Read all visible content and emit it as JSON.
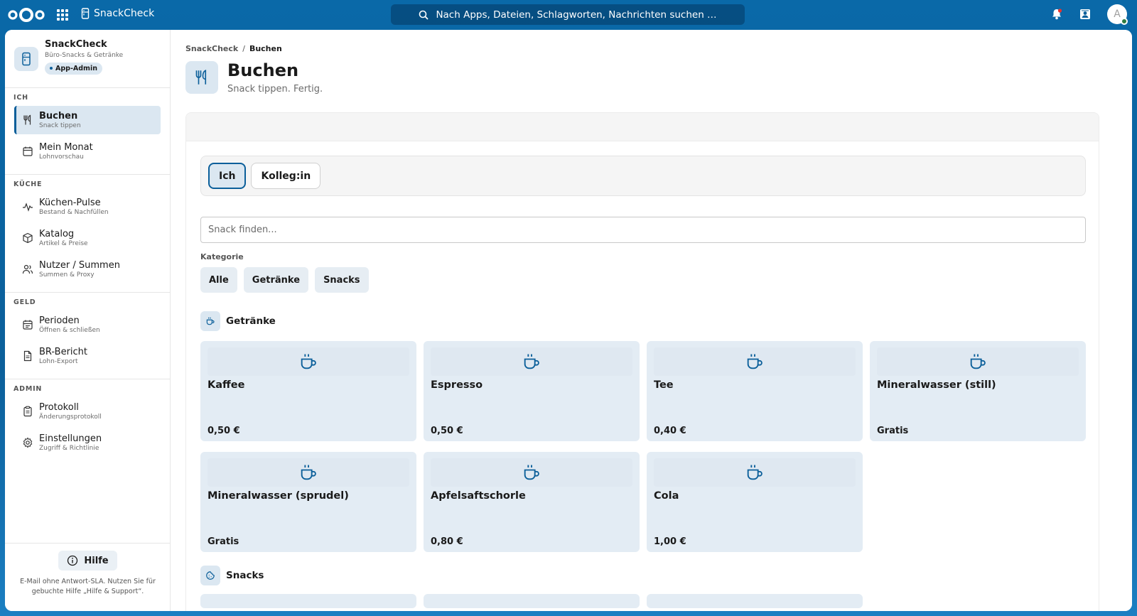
{
  "topbar": {
    "app_name": "SnackCheck",
    "search_placeholder": "Nach Apps, Dateien, Schlagworten, Nachrichten suchen …",
    "avatar_letter": "A"
  },
  "sidebar": {
    "title": "SnackCheck",
    "subtitle": "Büro-Snacks & Getränke",
    "badge": "App-Admin",
    "sections": [
      {
        "label": "ICH",
        "items": [
          {
            "label": "Buchen",
            "hint": "Snack tippen",
            "icon": "fork-knife-icon"
          },
          {
            "label": "Mein Monat",
            "hint": "Lohnvorschau",
            "icon": "calendar-icon"
          }
        ]
      },
      {
        "label": "KÜCHE",
        "items": [
          {
            "label": "Küchen-Pulse",
            "hint": "Bestand & Nachfüllen",
            "icon": "pulse-icon"
          },
          {
            "label": "Katalog",
            "hint": "Artikel & Preise",
            "icon": "box-icon"
          },
          {
            "label": "Nutzer / Summen",
            "hint": "Summen & Proxy",
            "icon": "users-icon"
          }
        ]
      },
      {
        "label": "GELD",
        "items": [
          {
            "label": "Perioden",
            "hint": "Öffnen & schließen",
            "icon": "calendar-icon"
          },
          {
            "label": "BR-Bericht",
            "hint": "Lohn-Export",
            "icon": "document-icon"
          }
        ]
      },
      {
        "label": "ADMIN",
        "items": [
          {
            "label": "Protokoll",
            "hint": "Änderungsprotokoll",
            "icon": "clipboard-icon"
          },
          {
            "label": "Einstellungen",
            "hint": "Zugriff & Richtlinie",
            "icon": "gear-icon"
          }
        ]
      }
    ],
    "help_label": "Hilfe",
    "footer_text": "E-Mail ohne Antwort-SLA. Nutzen Sie für gebuchte Hilfe „Hilfe & Support“."
  },
  "main": {
    "breadcrumb": {
      "home": "SnackCheck",
      "current": "Buchen"
    },
    "title": "Buchen",
    "subtitle": "Snack tippen. Fertig.",
    "who": {
      "me": "Ich",
      "colleague": "Kolleg:in"
    },
    "search_placeholder": "Snack finden...",
    "category_label": "Kategorie",
    "chips": [
      "Alle",
      "Getränke",
      "Snacks"
    ],
    "groups": [
      {
        "title": "Getränke",
        "items": [
          {
            "name": "Kaffee",
            "price": "0,50 €"
          },
          {
            "name": "Espresso",
            "price": "0,50 €"
          },
          {
            "name": "Tee",
            "price": "0,40 €"
          },
          {
            "name": "Mineralwasser (still)",
            "price": "Gratis"
          },
          {
            "name": "Mineralwasser (sprudel)",
            "price": "Gratis"
          },
          {
            "name": "Apfelsaftschorle",
            "price": "0,80 €"
          },
          {
            "name": "Cola",
            "price": "1,00 €"
          }
        ]
      },
      {
        "title": "Snacks",
        "items": []
      }
    ]
  },
  "colors": {
    "brand": "#0b5f9a",
    "accent_bg": "#dbe7f1"
  }
}
